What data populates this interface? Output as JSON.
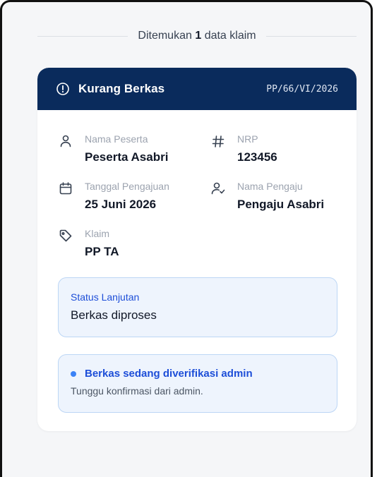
{
  "header": {
    "found_prefix": "Ditemukan",
    "found_count": "1",
    "found_suffix": "data klaim"
  },
  "card": {
    "status": "Kurang Berkas",
    "code": "PP/66/VI/2026",
    "fields": {
      "nama_peserta": {
        "label": "Nama Peserta",
        "value": "Peserta Asabri",
        "icon": "user-icon"
      },
      "nrp": {
        "label": "NRP",
        "value": "123456",
        "icon": "hash-icon"
      },
      "tanggal_pengajuan": {
        "label": "Tanggal Pengajuan",
        "value": "25 Juni 2026",
        "icon": "calendar-icon"
      },
      "nama_pengaju": {
        "label": "Nama Pengaju",
        "value": "Pengaju Asabri",
        "icon": "user-check-icon"
      },
      "klaim": {
        "label": "Klaim",
        "value": "PP TA",
        "icon": "tag-icon"
      }
    },
    "status_lanjutan": {
      "label": "Status Lanjutan",
      "value": "Berkas diproses"
    },
    "notice": {
      "title": "Berkas sedang diverifikasi admin",
      "subtitle": "Tunggu konfirmasi dari admin."
    }
  },
  "colors": {
    "header_bg": "#0a2b5c",
    "accent_blue": "#1d4ed8",
    "box_bg": "#eef4fd",
    "box_border": "#bcd6f5"
  }
}
